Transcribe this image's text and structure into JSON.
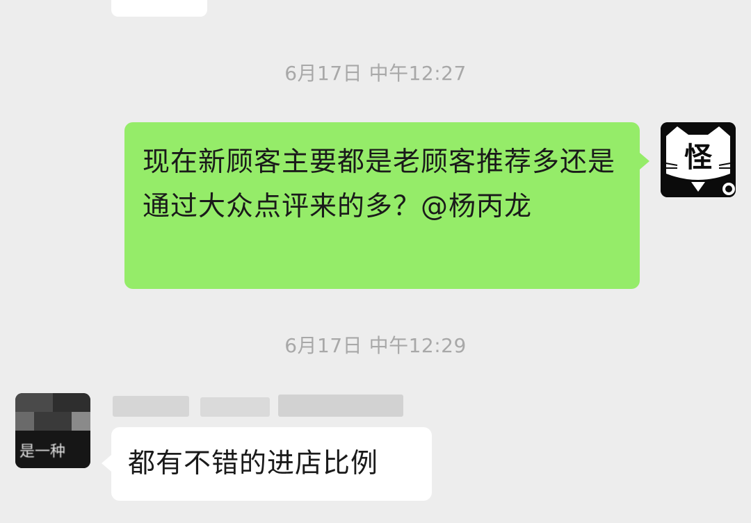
{
  "chat": {
    "messages": [
      {
        "timestamp": "6月17日 中午12:27",
        "sender": "self",
        "text": "现在新顾客主要都是老顾客推荐多还是通过大众点评来的多？@杨丙龙"
      },
      {
        "timestamp": "6月17日 中午12:29",
        "sender": "other",
        "text": "都有不错的进店比例"
      }
    ],
    "self_avatar": {
      "glyph": "怪",
      "icon": "cat-avatar-icon"
    },
    "other_avatar": {
      "icon": "pixelated-avatar-icon",
      "partial_text": "是一种"
    }
  },
  "colors": {
    "background": "#ededed",
    "outgoing_bubble": "#95ec69",
    "incoming_bubble": "#ffffff",
    "timestamp_text": "#a8a8a8"
  }
}
